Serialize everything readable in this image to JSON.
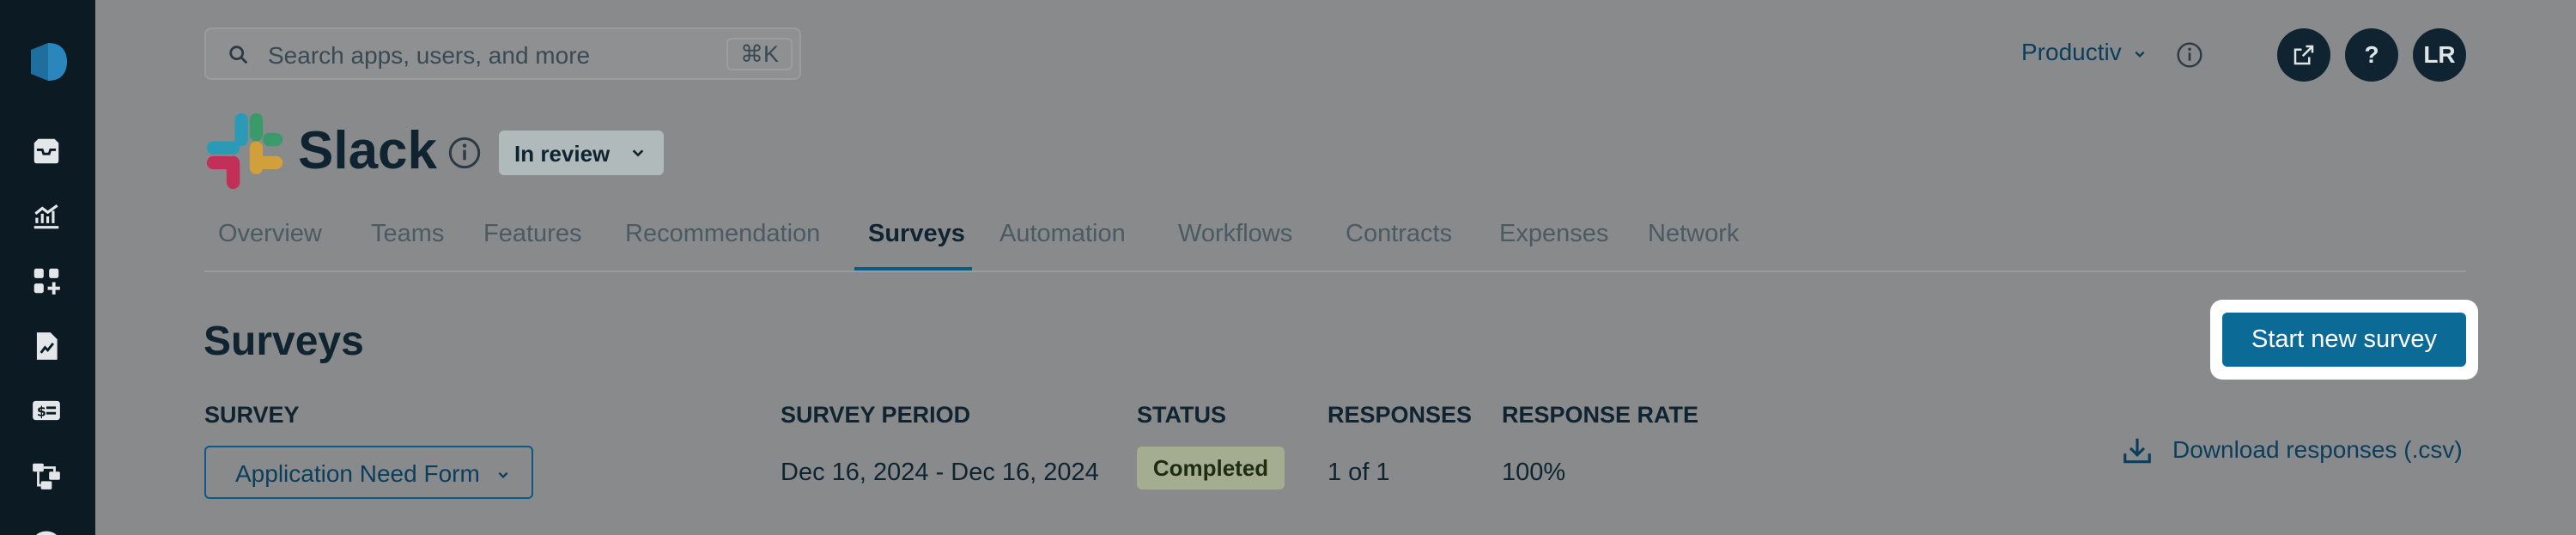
{
  "search": {
    "placeholder": "Search apps, users, and more",
    "shortcut": "⌘K"
  },
  "header": {
    "workspace": "Productiv",
    "actions": [
      "share-icon",
      "help-icon"
    ],
    "help_label": "?",
    "avatar_initials": "LR"
  },
  "app": {
    "name": "Slack",
    "status": "In review"
  },
  "tabs": [
    {
      "label": "Overview"
    },
    {
      "label": "Teams"
    },
    {
      "label": "Features"
    },
    {
      "label": "Recommendation"
    },
    {
      "label": "Surveys",
      "active": true
    },
    {
      "label": "Automation"
    },
    {
      "label": "Workflows"
    },
    {
      "label": "Contracts"
    },
    {
      "label": "Expenses"
    },
    {
      "label": "Network"
    }
  ],
  "surveys": {
    "title": "Surveys",
    "start_button": "Start new survey",
    "columns": [
      "SURVEY",
      "SURVEY PERIOD",
      "STATUS",
      "RESPONSES",
      "RESPONSE RATE"
    ],
    "row": {
      "survey": "Application Need Form",
      "period": "Dec 16, 2024 - Dec 16, 2024",
      "status": "Completed",
      "responses": "1 of 1",
      "response_rate": "100%"
    },
    "download": "Download responses (.csv)"
  },
  "colors": {
    "primary": "#0b6a96",
    "nav_bg": "#0c1a24",
    "text_dark": "#0f2430",
    "link": "#0b3e5c"
  }
}
